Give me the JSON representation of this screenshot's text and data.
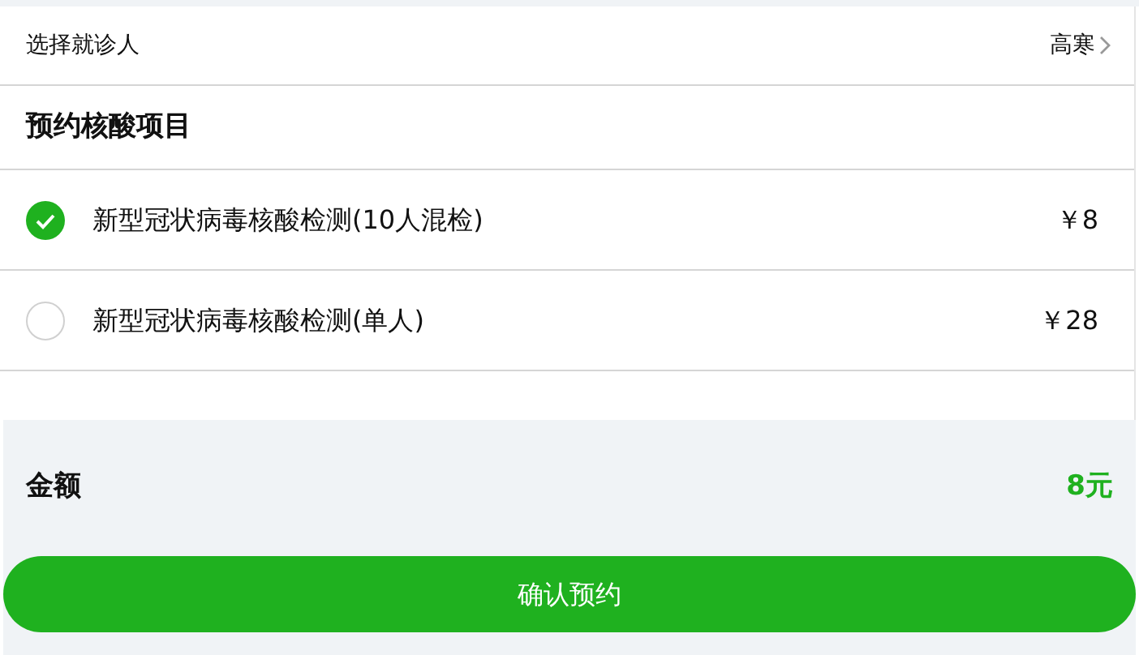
{
  "patient_row": {
    "label": "选择就诊人",
    "value": "高寒"
  },
  "section_title": "预约核酸项目",
  "items": [
    {
      "name": "新型冠状病毒核酸检测(10人混检)",
      "price": "￥8",
      "selected": true
    },
    {
      "name": "新型冠状病毒核酸检测(单人)",
      "price": "￥28",
      "selected": false
    }
  ],
  "total": {
    "label": "金额",
    "value": "8元"
  },
  "confirm_button": "确认预约"
}
